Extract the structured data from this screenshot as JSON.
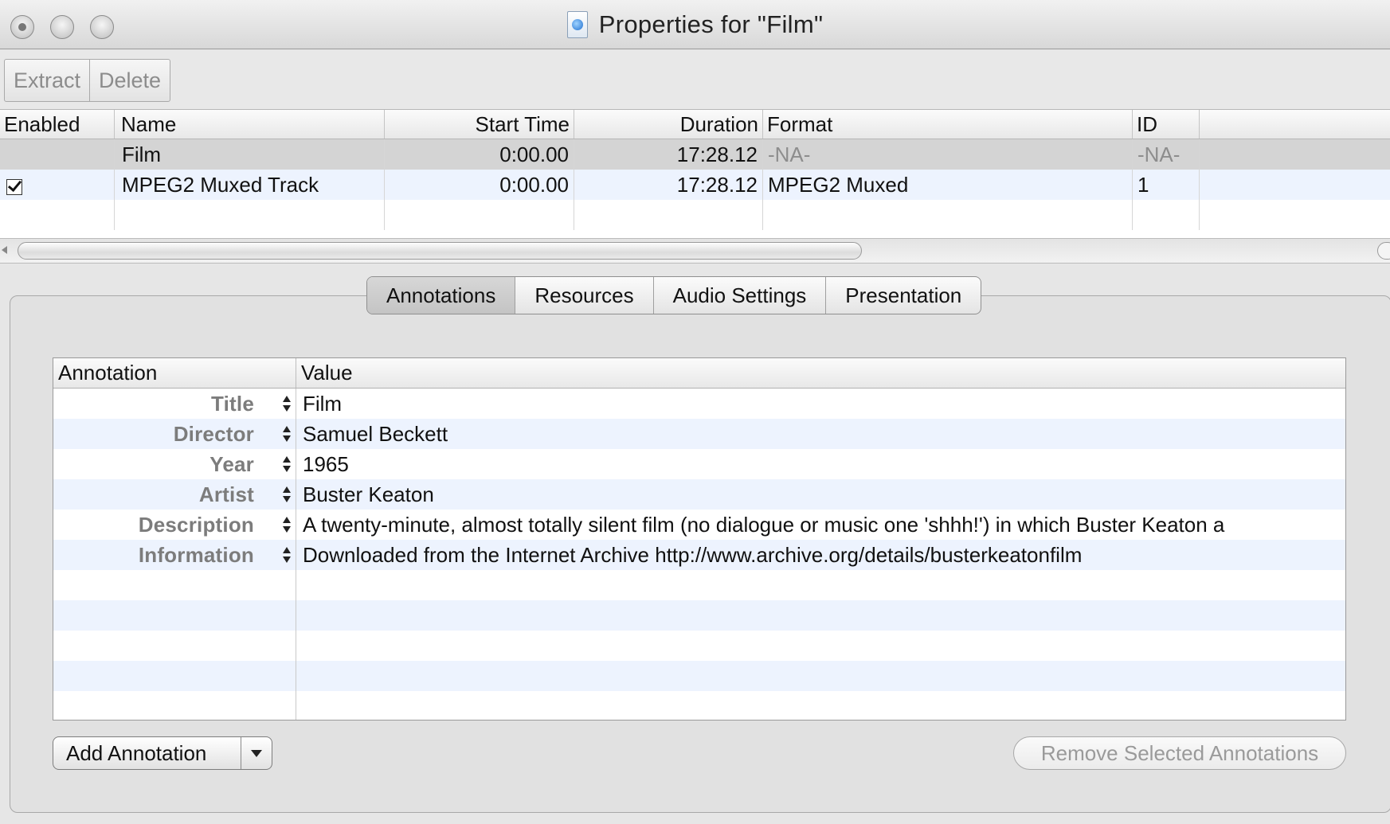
{
  "window": {
    "title": "Properties for \"Film\""
  },
  "toolbar": {
    "extract_label": "Extract",
    "delete_label": "Delete"
  },
  "tracks": {
    "columns": [
      "Enabled",
      "Name",
      "Start Time",
      "Duration",
      "Format",
      "ID"
    ],
    "rows": [
      {
        "enabled": false,
        "name": "Film",
        "start_time": "0:00.00",
        "duration": "17:28.12",
        "format": "-NA-",
        "id": "-NA-"
      },
      {
        "enabled": true,
        "name": "MPEG2 Muxed Track",
        "start_time": "0:00.00",
        "duration": "17:28.12",
        "format": "MPEG2 Muxed",
        "id": "1"
      }
    ]
  },
  "tabs": [
    {
      "label": "Annotations",
      "active": true
    },
    {
      "label": "Resources",
      "active": false
    },
    {
      "label": "Audio Settings",
      "active": false
    },
    {
      "label": "Presentation",
      "active": false
    }
  ],
  "annotations": {
    "columns": [
      "Annotation",
      "Value"
    ],
    "rows": [
      {
        "annotation": "Title",
        "value": "Film"
      },
      {
        "annotation": "Director",
        "value": "Samuel Beckett"
      },
      {
        "annotation": "Year",
        "value": "1965"
      },
      {
        "annotation": "Artist",
        "value": "Buster Keaton"
      },
      {
        "annotation": "Description",
        "value": "A twenty-minute, almost totally silent film (no dialogue or music one 'shhh!') in which Buster Keaton a"
      },
      {
        "annotation": "Information",
        "value": "Downloaded from the Internet Archive http://www.archive.org/details/busterkeatonfilm"
      }
    ]
  },
  "buttons": {
    "add_annotation": "Add Annotation",
    "remove_selected": "Remove Selected Annotations"
  }
}
